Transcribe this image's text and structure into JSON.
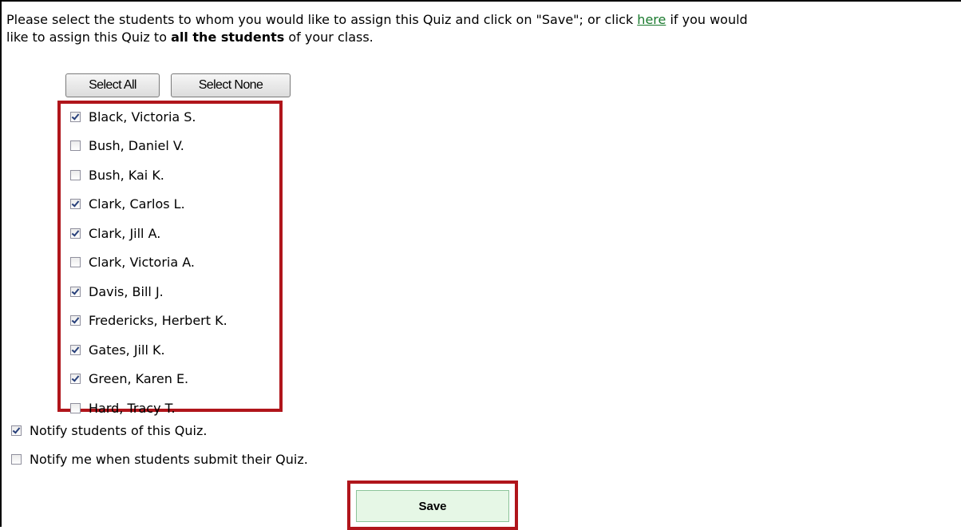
{
  "intro": {
    "part1": "Please select the students to whom you would like to assign this Quiz and click on \"Save\"; or click ",
    "link": "here",
    "part2": " if you would",
    "part3": "like to assign this Quiz to ",
    "bold": "all the students",
    "part4": " of your class."
  },
  "buttons": {
    "select_all": "Select All",
    "select_none": "Select None",
    "save": "Save"
  },
  "students": [
    {
      "name": "Black, Victoria S.",
      "checked": true
    },
    {
      "name": "Bush, Daniel V.",
      "checked": false
    },
    {
      "name": "Bush, Kai K.",
      "checked": false
    },
    {
      "name": "Clark, Carlos L.",
      "checked": true
    },
    {
      "name": "Clark, Jill A.",
      "checked": true
    },
    {
      "name": "Clark, Victoria A.",
      "checked": false
    },
    {
      "name": "Davis, Bill J.",
      "checked": true
    },
    {
      "name": "Fredericks, Herbert K.",
      "checked": true
    },
    {
      "name": "Gates, Jill K.",
      "checked": true
    },
    {
      "name": "Green, Karen E.",
      "checked": true
    },
    {
      "name": "Hard, Tracy T.",
      "checked": false
    }
  ],
  "notify": {
    "students_label": "Notify students of this Quiz.",
    "students_checked": true,
    "me_label": "Notify me when students submit their Quiz.",
    "me_checked": false
  },
  "colors": {
    "highlight_border": "#b0151b",
    "link": "#1a7a2e",
    "save_bg": "#e6f7e6"
  }
}
